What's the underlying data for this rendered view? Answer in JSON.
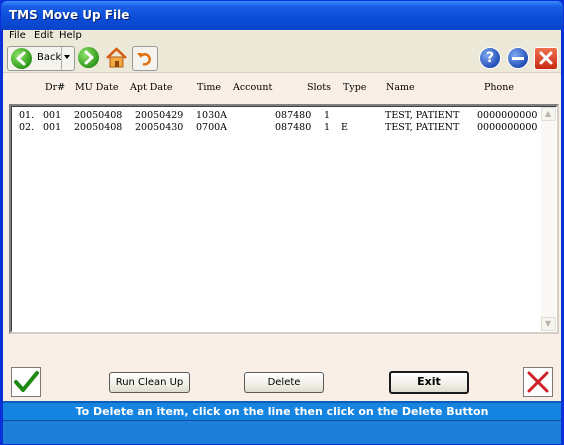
{
  "window": {
    "title": "TMS Move Up File"
  },
  "menu": {
    "file": "File",
    "edit": "Edit",
    "help": "Help"
  },
  "toolbar": {
    "back_label": "Back"
  },
  "table": {
    "headers": [
      "Dr#",
      "MU Date",
      "Apt Date",
      "Time",
      "Account",
      "Slots",
      "Type",
      "Name",
      "Phone"
    ],
    "rows": [
      {
        "index": "01.",
        "dr": "001",
        "mu_date": "20050408",
        "apt_date": "20050429",
        "time": "1030A",
        "account": "087480",
        "slots": "1",
        "type": "",
        "name": "TEST, PATIENT",
        "phone": "0000000000"
      },
      {
        "index": "02.",
        "dr": "001",
        "mu_date": "20050408",
        "apt_date": "20050430",
        "time": "0700A",
        "account": "087480",
        "slots": "1",
        "type": "E",
        "name": "TEST, PATIENT",
        "phone": "0000000000"
      }
    ]
  },
  "buttons": {
    "run_clean_up": "Run Clean Up",
    "delete": "Delete",
    "exit": "Exit"
  },
  "status": {
    "message": "To Delete an item, click on the line then click on the Delete Button"
  },
  "colors": {
    "title_bar": "#0A4CD8",
    "content_bg": "#FAEFE6",
    "status_bar": "#1584E0"
  }
}
